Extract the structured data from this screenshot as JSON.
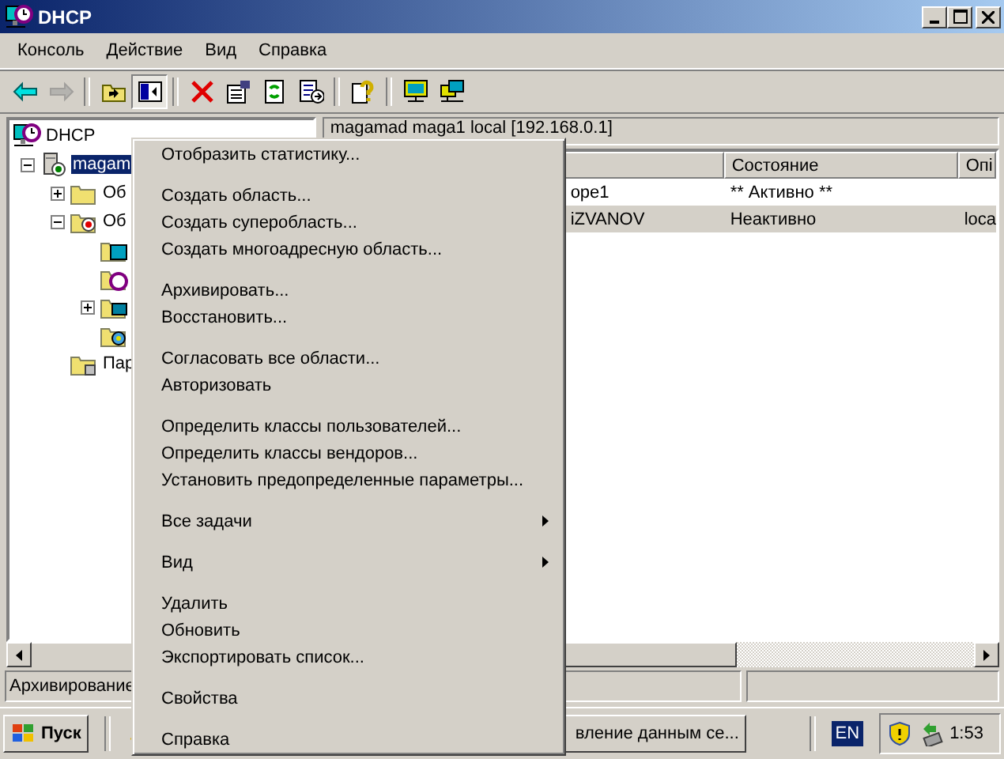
{
  "window": {
    "title": "DHCP"
  },
  "menubar": [
    "Консоль",
    "Действие",
    "Вид",
    "Справка"
  ],
  "toolbar": [
    {
      "kind": "back",
      "disabled": false
    },
    {
      "kind": "forward",
      "disabled": true
    },
    {
      "kind": "sep"
    },
    {
      "kind": "up",
      "disabled": false
    },
    {
      "kind": "tree",
      "disabled": false,
      "pressed": true
    },
    {
      "kind": "sep"
    },
    {
      "kind": "delete",
      "disabled": false
    },
    {
      "kind": "properties",
      "disabled": false
    },
    {
      "kind": "refresh",
      "disabled": false
    },
    {
      "kind": "export",
      "disabled": false
    },
    {
      "kind": "sep"
    },
    {
      "kind": "help",
      "disabled": false
    },
    {
      "kind": "sep"
    },
    {
      "kind": "monitor",
      "disabled": false
    },
    {
      "kind": "monitors",
      "disabled": false
    }
  ],
  "tree": [
    {
      "label": "DHCP",
      "kind": "dhcp",
      "selected": false,
      "children": [
        {
          "label": "magam",
          "kind": "server",
          "selected": true,
          "expanded": true,
          "children": [
            {
              "label": "Об",
              "kind": "folder",
              "selected": false,
              "expanded": false
            },
            {
              "label": "Об",
              "kind": "scope",
              "selected": false,
              "expanded": true,
              "children": [
                {
                  "kind": "pool"
                },
                {
                  "kind": "lease"
                },
                {
                  "kind": "reservation",
                  "expanded": false
                },
                {
                  "kind": "options"
                }
              ]
            },
            {
              "label": "Пар",
              "kind": "policy",
              "selected": false
            }
          ]
        }
      ]
    }
  ],
  "details": {
    "header": "magamad maga1 local [192.168.0.1]",
    "columns": [
      "",
      "Состояние",
      "Опі"
    ],
    "rows": [
      {
        "cells": [
          "ope1",
          "** Активно **",
          ""
        ],
        "selected": false
      },
      {
        "cells": [
          "iZVANOV",
          "Неактивно",
          "loca"
        ],
        "selected": true
      }
    ]
  },
  "status_bar": [
    "Архивирование"
  ],
  "context_menu": [
    {
      "kind": "item",
      "label": "Отобразить статистику..."
    },
    {
      "kind": "separator"
    },
    {
      "kind": "item",
      "label": "Создать область..."
    },
    {
      "kind": "item",
      "label": "Создать суперобласть..."
    },
    {
      "kind": "item",
      "label": "Создать многоадресную область..."
    },
    {
      "kind": "separator"
    },
    {
      "kind": "item",
      "label": "Архивировать..."
    },
    {
      "kind": "item",
      "label": "Восстановить..."
    },
    {
      "kind": "separator"
    },
    {
      "kind": "item",
      "label": "Согласовать все области..."
    },
    {
      "kind": "item",
      "label": "Авторизовать"
    },
    {
      "kind": "separator"
    },
    {
      "kind": "item",
      "label": "Определить классы пользователей..."
    },
    {
      "kind": "item",
      "label": "Определить классы вендоров..."
    },
    {
      "kind": "item",
      "label": "Установить предопределенные параметры..."
    },
    {
      "kind": "separator"
    },
    {
      "kind": "submenu",
      "label": "Все задачи"
    },
    {
      "kind": "separator"
    },
    {
      "kind": "submenu",
      "label": "Вид"
    },
    {
      "kind": "separator"
    },
    {
      "kind": "item",
      "label": "Удалить"
    },
    {
      "kind": "item",
      "label": "Обновить"
    },
    {
      "kind": "item",
      "label": "Экспортировать список..."
    },
    {
      "kind": "separator"
    },
    {
      "kind": "item",
      "label": "Свойства"
    },
    {
      "kind": "separator"
    },
    {
      "kind": "item",
      "label": "Справка"
    }
  ],
  "taskbar": {
    "start": "Пуск",
    "task": "вление данным се...",
    "language": "EN",
    "clock": "1:53"
  }
}
